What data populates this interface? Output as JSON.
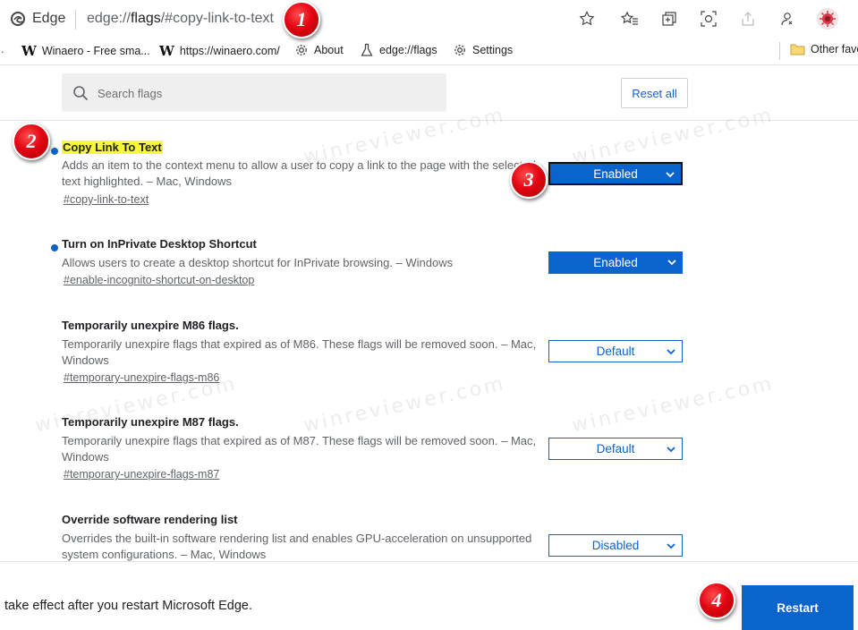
{
  "browser": {
    "brand": "Edge",
    "url_prefix": "edge://",
    "url_host": "flags",
    "url_rest": "/#copy-link-to-text"
  },
  "bookmarks": [
    {
      "label": "Winaero - Free sma...",
      "icon": "winaero-w-icon"
    },
    {
      "label": "https://winaero.com/",
      "icon": "winaero-w-icon"
    },
    {
      "label": "About",
      "icon": "gear-icon"
    },
    {
      "label": "edge://flags",
      "icon": "flask-icon"
    },
    {
      "label": "Settings",
      "icon": "gear-icon"
    }
  ],
  "bookmarks_other": {
    "label": "Other favo",
    "icon": "folder-icon"
  },
  "search": {
    "placeholder": "Search flags"
  },
  "reset_label": "Reset all",
  "flags": [
    {
      "name": "Copy Link To Text",
      "description": "Adds an item to the context menu to allow a user to copy a link to the page with the selected text highlighted. – Mac, Windows",
      "tag": "#copy-link-to-text",
      "value": "Enabled",
      "modified": true
    },
    {
      "name": "Turn on InPrivate Desktop Shortcut",
      "description": "Allows users to create a desktop shortcut for InPrivate browsing. – Windows",
      "tag": "#enable-incognito-shortcut-on-desktop",
      "value": "Enabled",
      "modified": true
    },
    {
      "name": "Temporarily unexpire M86 flags.",
      "description": "Temporarily unexpire flags that expired as of M86. These flags will be removed soon. – Mac, Windows",
      "tag": "#temporary-unexpire-flags-m86",
      "value": "Default",
      "modified": false
    },
    {
      "name": "Temporarily unexpire M87 flags.",
      "description": "Temporarily unexpire flags that expired as of M87. These flags will be removed soon. – Mac, Windows",
      "tag": "#temporary-unexpire-flags-m87",
      "value": "Default",
      "modified": false
    },
    {
      "name": "Override software rendering list",
      "description": "Overrides the built-in software rendering list and enables GPU-acceleration on unsupported system configurations. – Mac, Windows",
      "tag": "",
      "value": "Disabled",
      "modified": false
    }
  ],
  "restart_message": "take effect after you restart Microsoft Edge.",
  "restart_label": "Restart",
  "markers": [
    "1",
    "2",
    "3",
    "4"
  ],
  "watermark": "winreviewer.com",
  "colors": {
    "accent": "#0b63ce",
    "highlight": "#f9f73b",
    "marker": "#e30613"
  }
}
